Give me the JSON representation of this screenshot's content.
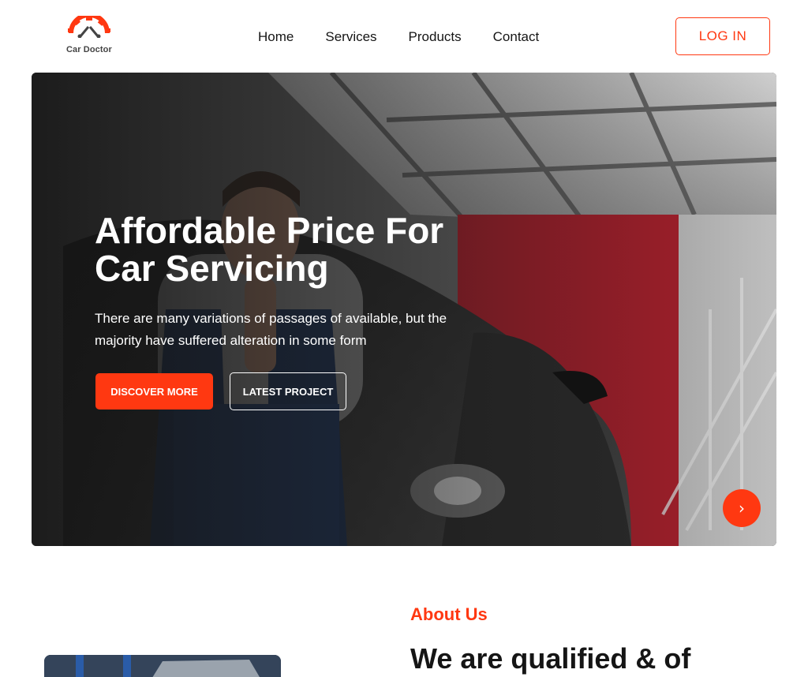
{
  "brand": {
    "name": "Car Doctor",
    "accent": "#FF3811"
  },
  "nav": {
    "items": [
      {
        "label": "Home"
      },
      {
        "label": "Services"
      },
      {
        "label": "Products"
      },
      {
        "label": "Contact"
      }
    ],
    "login_label": "LOG IN"
  },
  "hero": {
    "title": "Affordable Price For Car Servicing",
    "description": "There are many variations of passages of available, but the majority have suffered alteration in some form",
    "primary_button": "DISCOVER MORE",
    "secondary_button": "LATEST PROJECT",
    "next_icon": "chevron-right-icon"
  },
  "about": {
    "label": "About Us",
    "title": "We are qualified & of"
  }
}
